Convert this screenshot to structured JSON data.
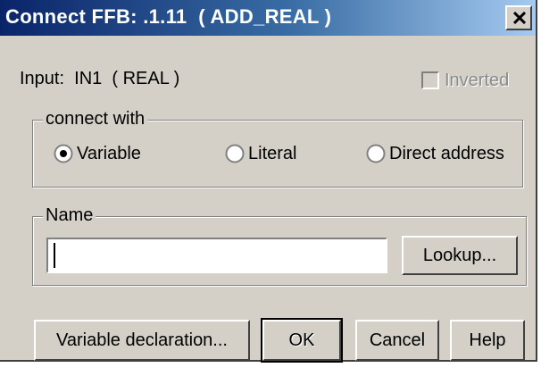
{
  "window": {
    "title": "Connect FFB: .1.11  ( ADD_REAL )",
    "close_glyph": "X"
  },
  "input_info": {
    "text": "Input:  IN1  ( REAL )"
  },
  "inverted": {
    "label": "Inverted",
    "checked": false,
    "enabled": false
  },
  "connect_with": {
    "legend": "connect with",
    "selected": "Variable",
    "options": [
      {
        "label": "Variable",
        "selected": true
      },
      {
        "label": "Literal",
        "selected": false
      },
      {
        "label": "Direct address",
        "selected": false
      }
    ]
  },
  "name_group": {
    "legend": "Name",
    "value": "",
    "lookup_label": "Lookup..."
  },
  "buttons": {
    "variable_declaration": "Variable declaration...",
    "ok": "OK",
    "cancel": "Cancel",
    "help": "Help"
  },
  "colors": {
    "face": "#d4d0c8",
    "title_start": "#0a246a",
    "title_end": "#a6caf0"
  }
}
